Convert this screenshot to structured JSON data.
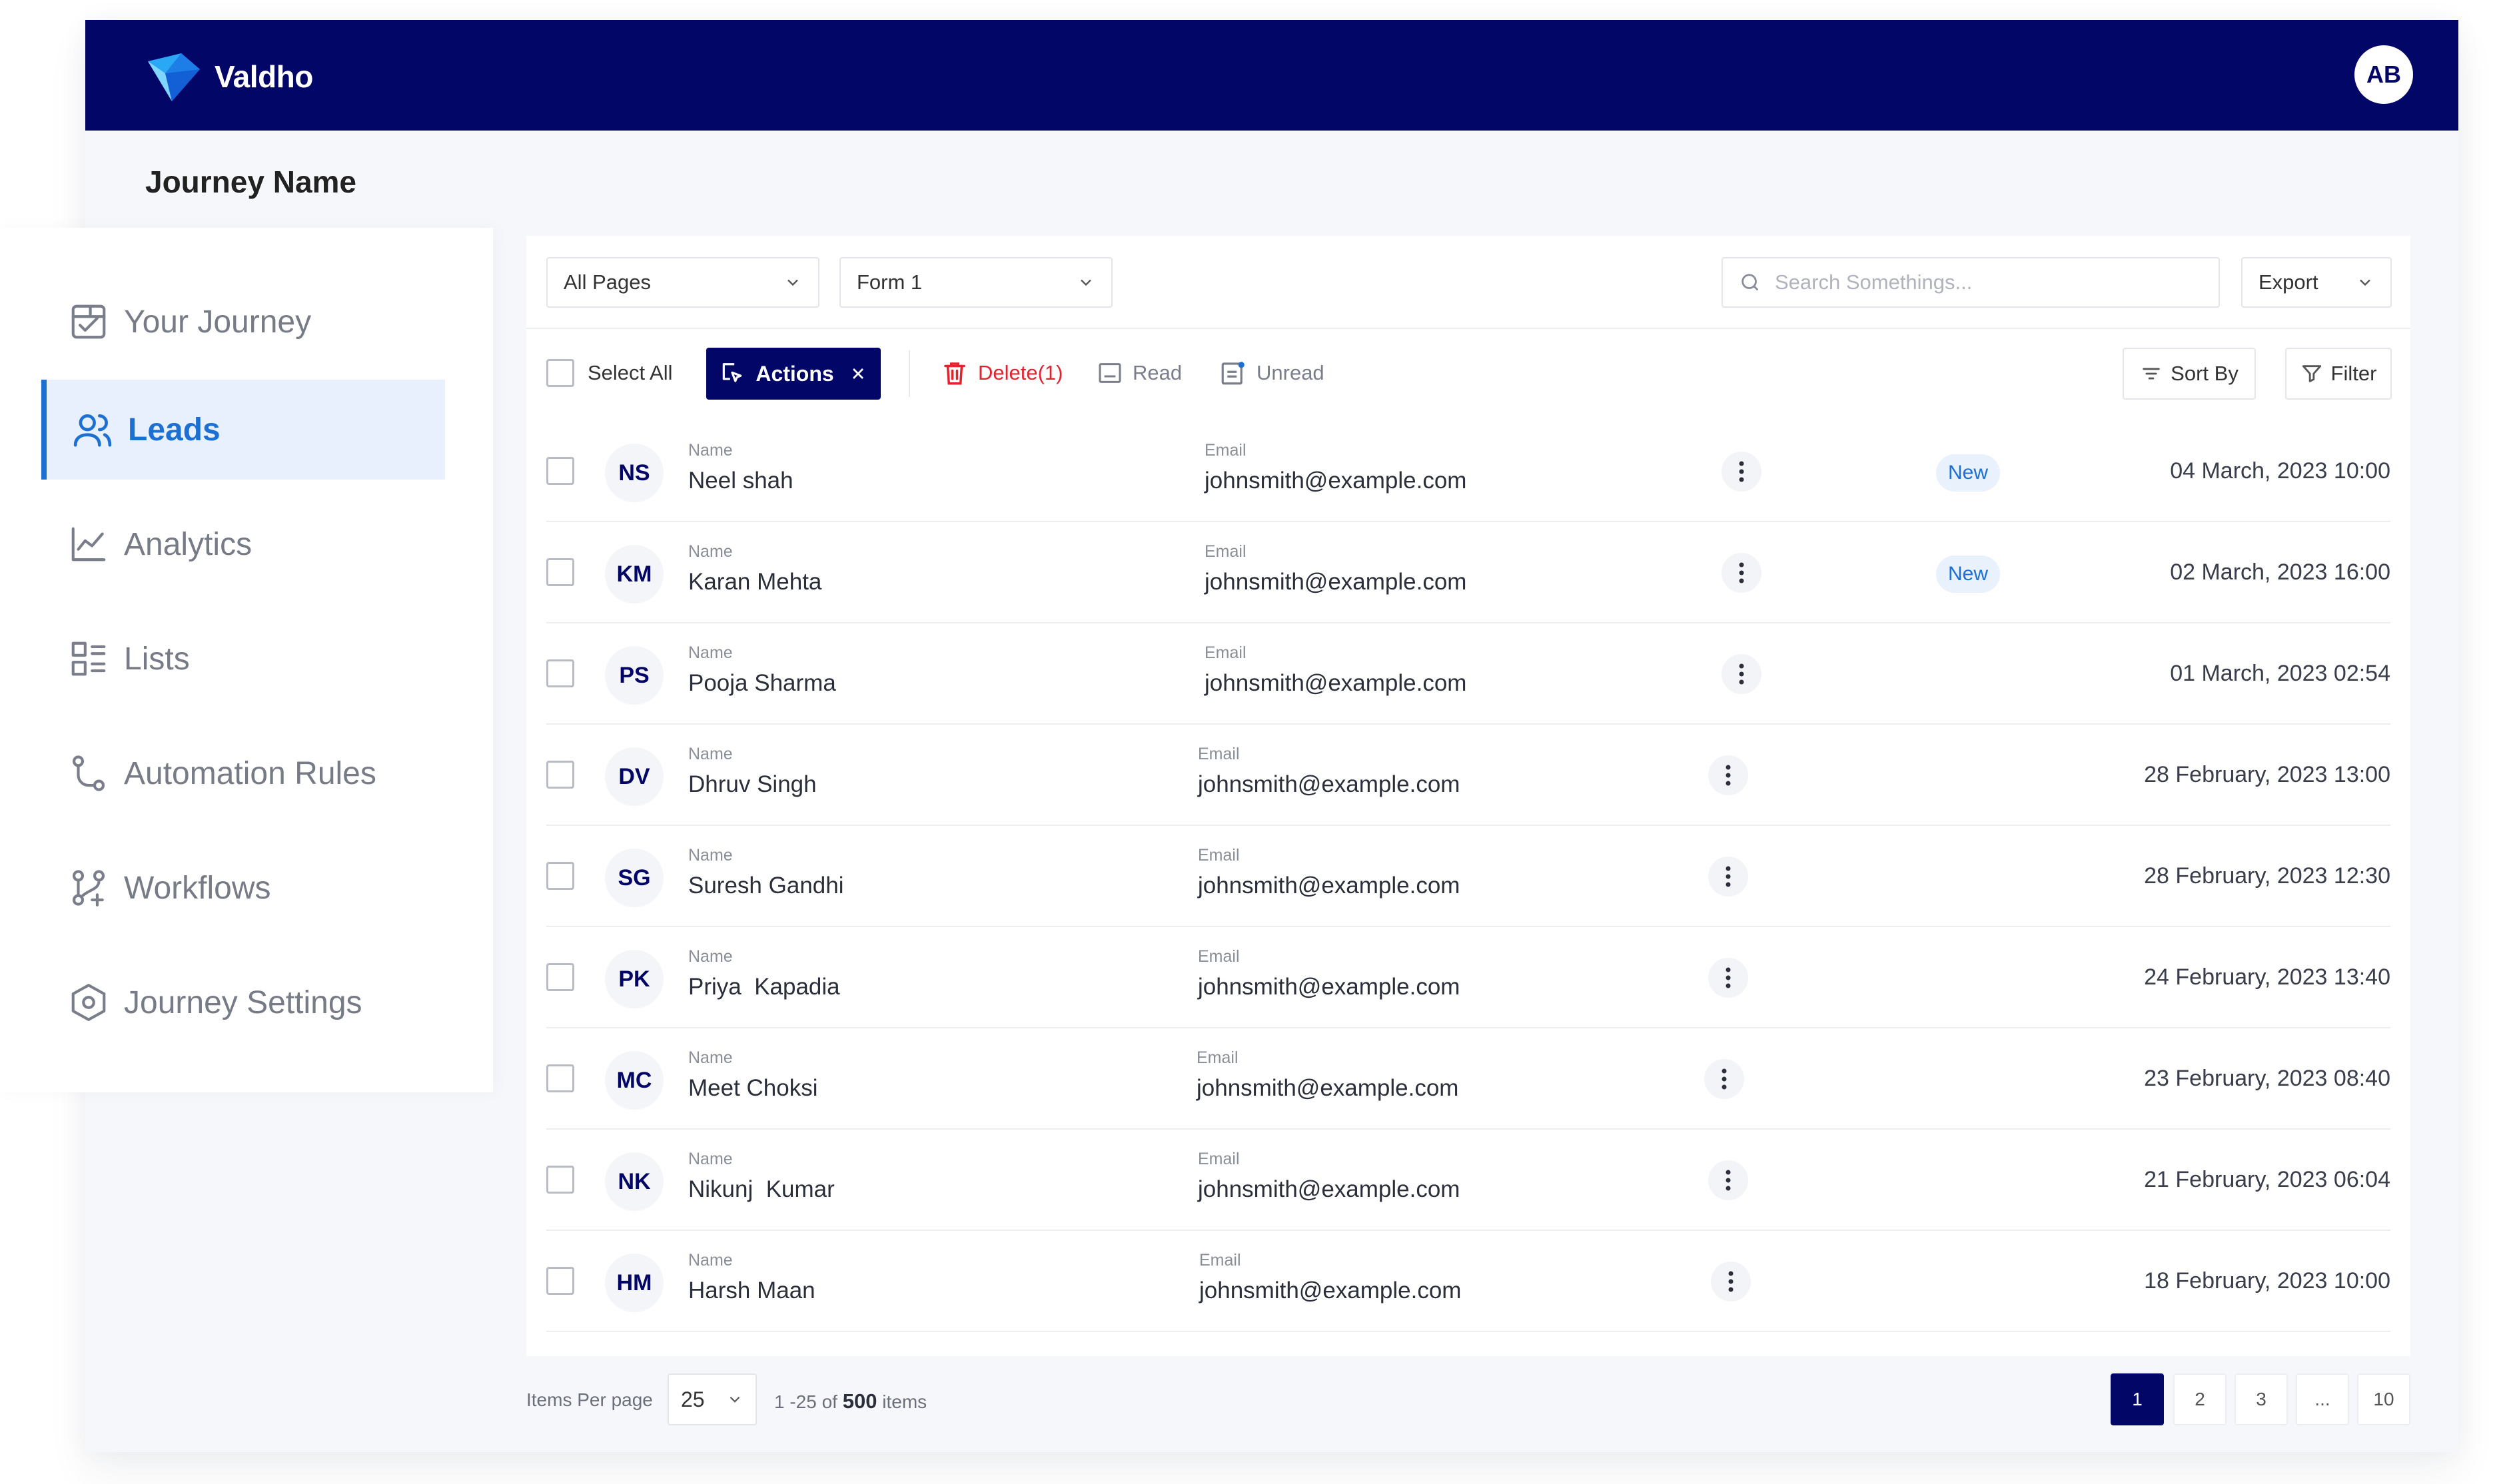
{
  "app": {
    "brand": "Valdho",
    "user_initials": "AB"
  },
  "page_title": "Journey Name",
  "sidebar": {
    "items": [
      {
        "label": "Your Journey",
        "icon": "journey-icon",
        "active": false
      },
      {
        "label": "Leads",
        "icon": "users-icon",
        "active": true
      },
      {
        "label": "Analytics",
        "icon": "analytics-icon",
        "active": false
      },
      {
        "label": "Lists",
        "icon": "lists-icon",
        "active": false
      },
      {
        "label": "Automation Rules",
        "icon": "automation-icon",
        "active": false
      },
      {
        "label": "Workflows",
        "icon": "workflows-icon",
        "active": false
      },
      {
        "label": "Journey Settings",
        "icon": "settings-hexagon-icon",
        "active": false
      }
    ]
  },
  "filters": {
    "pages_select": "All Pages",
    "form_select": "Form 1",
    "search_placeholder": "Search Somethings...",
    "export_label": "Export"
  },
  "toolbar": {
    "select_all": "Select All",
    "actions": "Actions",
    "delete": "Delete(1)",
    "read": "Read",
    "unread": "Unread",
    "sort_by": "Sort By",
    "filter": "Filter"
  },
  "table": {
    "name_label": "Name",
    "email_label": "Email",
    "rows": [
      {
        "initials": "NS",
        "name": "Neel shah",
        "email": "johnsmith@example.com",
        "badge": "New",
        "date": "04 March, 2023 10:00"
      },
      {
        "initials": "KM",
        "name": "Karan Mehta",
        "email": "johnsmith@example.com",
        "badge": "New",
        "date": "02 March, 2023 16:00"
      },
      {
        "initials": "PS",
        "name": "Pooja Sharma",
        "email": "johnsmith@example.com",
        "badge": "",
        "date": "01 March, 2023 02:54"
      },
      {
        "initials": "DV",
        "name": "Dhruv Singh",
        "email": "johnsmith@example.com",
        "badge": "",
        "date": "28 February, 2023 13:00"
      },
      {
        "initials": "SG",
        "name": "Suresh Gandhi",
        "email": "johnsmith@example.com",
        "badge": "",
        "date": "28 February, 2023 12:30"
      },
      {
        "initials": "PK",
        "name": "Priya  Kapadia",
        "email": "johnsmith@example.com",
        "badge": "",
        "date": "24 February, 2023 13:40"
      },
      {
        "initials": "MC",
        "name": "Meet Choksi",
        "email": "johnsmith@example.com",
        "badge": "",
        "date": "23 February, 2023 08:40"
      },
      {
        "initials": "NK",
        "name": "Nikunj  Kumar",
        "email": "johnsmith@example.com",
        "badge": "",
        "date": "21 February, 2023 06:04"
      },
      {
        "initials": "HM",
        "name": "Harsh Maan",
        "email": "johnsmith@example.com",
        "badge": "",
        "date": "18 February, 2023 10:00"
      }
    ]
  },
  "pagination": {
    "items_per_page_label": "Items Per page",
    "items_per_page": "25",
    "range_text": "1 -25 of",
    "total": "500",
    "items_word": "items",
    "pages": [
      "1",
      "2",
      "3",
      "...",
      "10"
    ],
    "current_page": "1"
  },
  "colors": {
    "navy": "#020667",
    "accent_blue": "#1c6fd3",
    "danger": "#e0242f"
  }
}
